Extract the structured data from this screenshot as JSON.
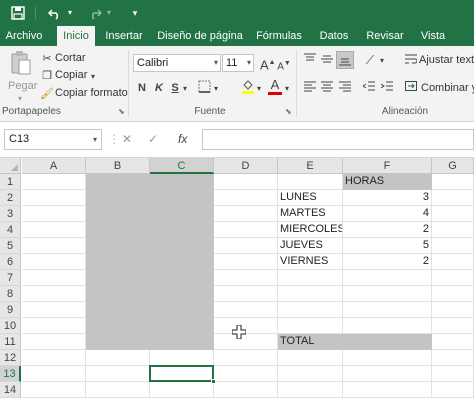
{
  "titlebar": {
    "save_icon": "save-icon",
    "undo_icon": "undo-icon",
    "redo_icon": "redo-icon",
    "customize_icon": "customize-quick-access-icon"
  },
  "tabs": [
    "Archivo",
    "Inicio",
    "Insertar",
    "Diseño de página",
    "Fórmulas",
    "Datos",
    "Revisar",
    "Vista"
  ],
  "active_tab": "Inicio",
  "ribbon": {
    "clipboard": {
      "paste_label": "Pegar",
      "cut_label": "Cortar",
      "copy_label": "Copiar",
      "format_painter_label": "Copiar formato",
      "group_label": "Portapapeles"
    },
    "font": {
      "font_name": "Calibri",
      "font_size": "11",
      "bold": "N",
      "italic": "K",
      "underline": "S",
      "grow": "A",
      "shrink": "A",
      "font_color": "A",
      "group_label": "Fuente"
    },
    "alignment": {
      "wrap_text_label": "Ajustar texto",
      "merge_label": "Combinar y",
      "group_label": "Alineación"
    }
  },
  "formula_bar": {
    "name_box": "C13",
    "cancel_icon": "✕",
    "enter_icon": "✓",
    "fx_label": "fx",
    "formula": ""
  },
  "columns": [
    "A",
    "B",
    "C",
    "D",
    "E",
    "F",
    "G"
  ],
  "selected_column": "C",
  "rows": [
    "1",
    "2",
    "3",
    "4",
    "5",
    "6",
    "7",
    "8",
    "9",
    "10",
    "11",
    "12",
    "13",
    "14"
  ],
  "selected_row": "13",
  "cells": {
    "F1": "HORAS",
    "E2": "LUNES",
    "F2": "3",
    "E3": "MARTES",
    "F3": "4",
    "E4": "MIERCOLES",
    "F4": "2",
    "E5": "JUEVES",
    "F5": "5",
    "E6": "VIERNES",
    "F6": "2",
    "E11": "TOTAL"
  },
  "colors": {
    "accent": "#217346",
    "shaded_cells": "#c4c4c4"
  }
}
